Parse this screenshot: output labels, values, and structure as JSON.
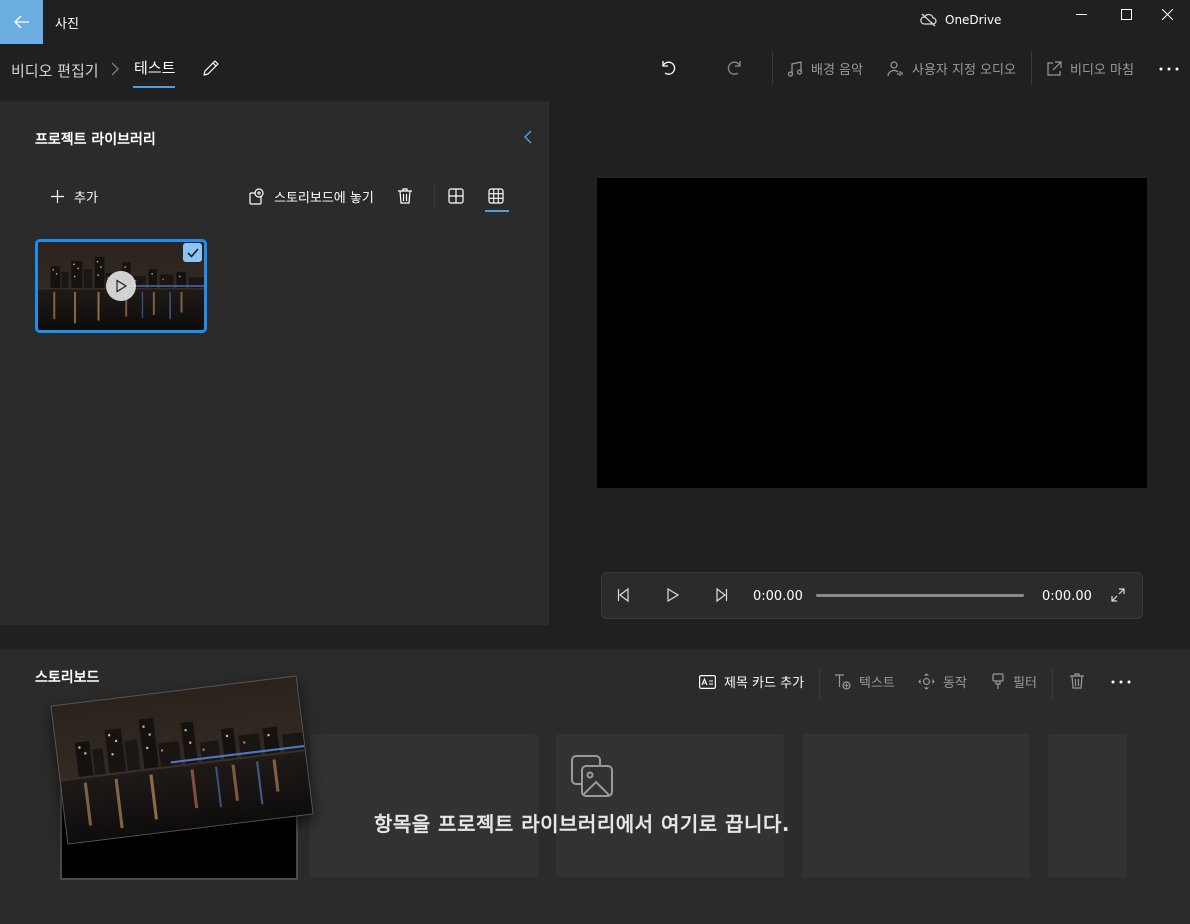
{
  "app": {
    "title": "사진",
    "onedrive_label": "OneDrive"
  },
  "breadcrumb": {
    "root": "비디오 편집기",
    "current": "테스트"
  },
  "toolbar": {
    "background_music": "배경 음악",
    "custom_audio": "사용자 지정 오디오",
    "finish_video": "비디오 마침"
  },
  "library": {
    "title": "프로젝트 라이브러리",
    "add_label": "추가",
    "place_label": "스토리보드에 놓기"
  },
  "player": {
    "time_current": "0:00.00",
    "time_total": "0:00.00",
    "progress": 0
  },
  "storyboard": {
    "title": "스토리보드",
    "add_title_card": "제목 카드 추가",
    "text": "텍스트",
    "motion": "동작",
    "filter": "필터",
    "drop_hint": "항목을 프로젝트 라이브러리에서 여기로 끕니다."
  },
  "colors": {
    "accent": "#1f8ef1",
    "back_button": "#6aaee2",
    "background": "#202020",
    "panel": "#2b2b2b"
  },
  "icons": {
    "back": "arrow-left-icon",
    "onedrive": "cloud-off-icon",
    "undo": "undo-icon",
    "redo": "redo-icon",
    "music": "music-note-icon",
    "custom_audio": "person-audio-icon",
    "share": "share-icon",
    "more": "more-icon"
  }
}
